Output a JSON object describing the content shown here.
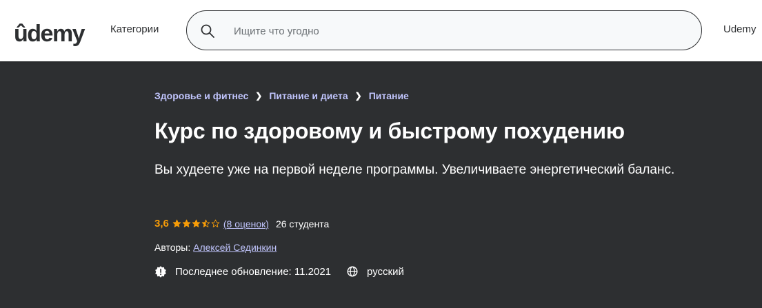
{
  "header": {
    "logo_text": "ûdemy",
    "categories_label": "Категории",
    "search_placeholder": "Ищите что угодно",
    "nav_right_label": "Udemy",
    "brand_color": "#a435f0",
    "search_icon": "search-icon"
  },
  "breadcrumb": [
    {
      "label": "Здоровье и фитнес"
    },
    {
      "label": "Питание и диета"
    },
    {
      "label": "Питание"
    }
  ],
  "course": {
    "title": "Курс по здоровому и быстрому похудению",
    "subtitle": "Вы худеете уже на первой неделе программы. Увеличиваете энергетический баланс.",
    "rating_value": "3,6",
    "rating_stars": 3.5,
    "rating_max": 5,
    "reviews_label": "(8 оценок)",
    "students_label": "26 студента",
    "authors_prefix": "Авторы:",
    "author_name": "Алексей Сединкин",
    "last_updated": "Последнее обновление: 11.2021",
    "language": "русский"
  },
  "colors": {
    "background_dark": "#2d2f31",
    "link_purple": "#c0c4fc",
    "rating_orange": "#f69c08"
  }
}
